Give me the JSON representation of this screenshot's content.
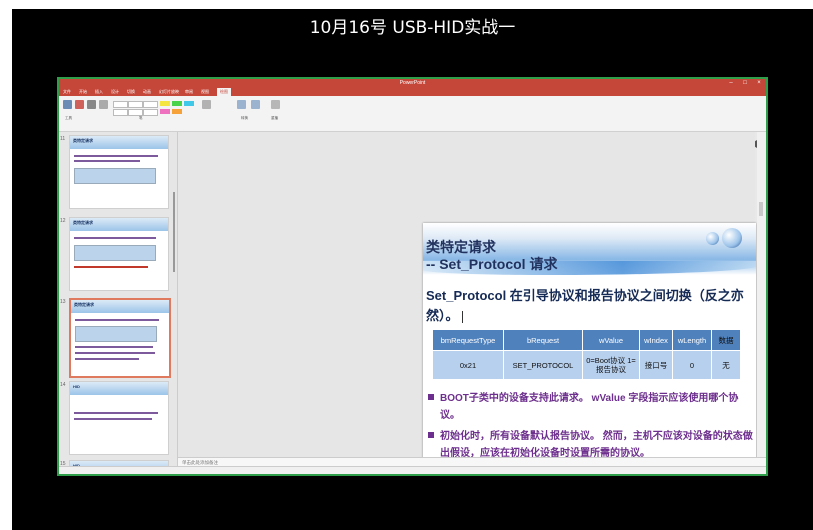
{
  "video_title": "10月16号 USB-HID实战一",
  "window": {
    "title": "PowerPoint",
    "tabs": [
      "文件",
      "开始",
      "插入",
      "设计",
      "切换",
      "动画",
      "幻灯片放映",
      "审阅",
      "视图",
      "绘图"
    ],
    "active_tab": "绘图"
  },
  "ribbon": {
    "groups": [
      "工具",
      "笔",
      "转换",
      "重播"
    ]
  },
  "thumbnails": [
    {
      "number": "11",
      "heading": "类特定请求"
    },
    {
      "number": "12",
      "heading": "类特定请求"
    },
    {
      "number": "13",
      "heading": "类特定请求"
    },
    {
      "number": "14",
      "heading": "HID"
    },
    {
      "number": "15",
      "heading": "HID"
    }
  ],
  "slide": {
    "title_line1": "类特定请求",
    "title_line2": "-- Set_Protocol 请求",
    "lead": "Set_Protocol 在引导协议和报告协议之间切换（反之亦然）。",
    "table": {
      "headers": [
        "bmRequestType",
        "bRequest",
        "wValue",
        "wIndex",
        "wLength",
        "数据"
      ],
      "row": [
        "0x21",
        "SET_PROTOCOL",
        "0=Boot协议 1=报告协议",
        "接口号",
        "0",
        "无"
      ]
    },
    "bullets": [
      "BOOT子类中的设备支持此请求。 wValue 字段指示应该使用哪个协议。",
      "初始化时，所有设备默认报告协议。 然而，主机不应该对设备的状态做出假设，应该在初始化设备时设置所需的协议。"
    ]
  },
  "notes_placeholder": "单击此处添加备注"
}
